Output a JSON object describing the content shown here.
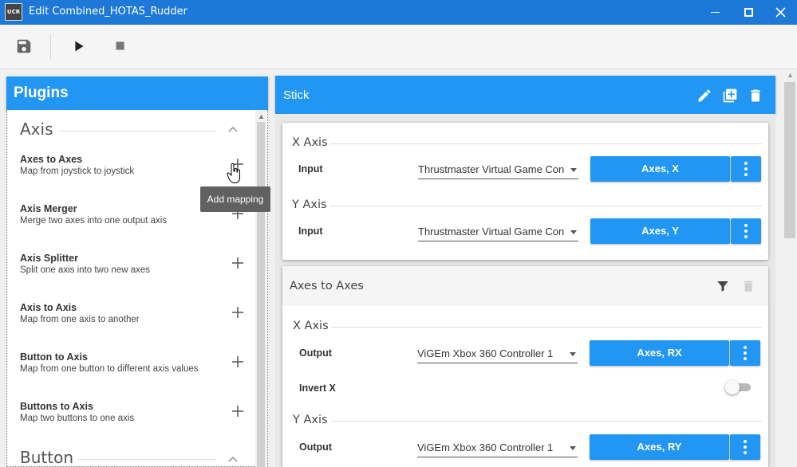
{
  "window": {
    "title": "Edit Combined_HOTAS_Rudder",
    "app_icon_text": "UCR"
  },
  "toolbar": {
    "icons": [
      "save-icon",
      "play-icon",
      "stop-icon"
    ]
  },
  "plugins": {
    "header": "Plugins",
    "sections": [
      {
        "title": "Axis",
        "items": [
          {
            "name": "Axes to Axes",
            "desc": "Map from joystick to joystick"
          },
          {
            "name": "Axis Merger",
            "desc": "Merge two axes into one output axis"
          },
          {
            "name": "Axis Splitter",
            "desc": "Split one axis into two new axes"
          },
          {
            "name": "Axis to Axis",
            "desc": "Map from one axis to another"
          },
          {
            "name": "Button to Axis",
            "desc": "Map from one button to different axis values"
          },
          {
            "name": "Buttons to Axis",
            "desc": "Map two buttons to one axis"
          }
        ]
      },
      {
        "title": "Button",
        "items": []
      }
    ],
    "tooltip": "Add mapping"
  },
  "stick": {
    "title": "Stick",
    "input_card": {
      "groups": [
        {
          "axis": "X Axis",
          "row_label": "Input",
          "device": "Thrustmaster Virtual Game Con",
          "binding": "Axes, X"
        },
        {
          "axis": "Y Axis",
          "row_label": "Input",
          "device": "Thrustmaster Virtual Game Con",
          "binding": "Axes, Y"
        }
      ]
    },
    "plugin_card": {
      "title": "Axes to Axes",
      "groups": [
        {
          "axis": "X Axis",
          "row_label": "Output",
          "device": "ViGEm Xbox 360 Controller 1",
          "binding": "Axes, RX"
        },
        {
          "axis": "Y Axis",
          "row_label": "Output",
          "device": "ViGEm Xbox 360 Controller 1",
          "binding": "Axes, RY"
        }
      ],
      "invert_label": "Invert X",
      "invert_on": false
    }
  },
  "colors": {
    "accent": "#2196f3",
    "titlebar": "#1e78d7"
  }
}
